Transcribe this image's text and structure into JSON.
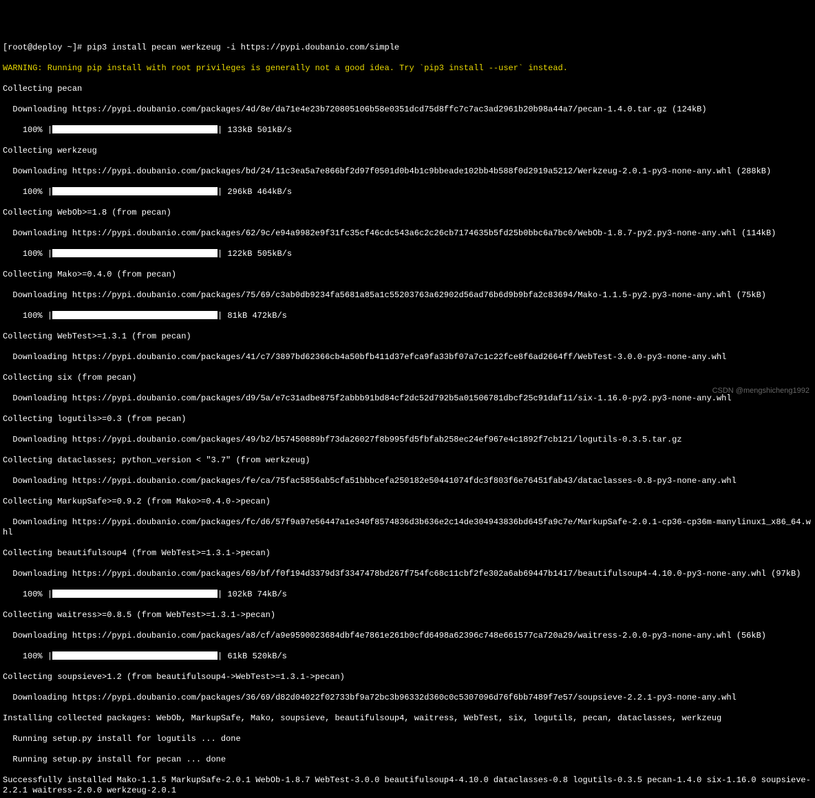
{
  "prompt": "[root@deploy ~]# pip3 install pecan werkzeug -i https://pypi.doubanio.com/simple",
  "warning": "WARNING: Running pip install with root privileges is generally not a good idea. Try `pip3 install --user` instead.",
  "l01": "Collecting pecan",
  "l02": "  Downloading https://pypi.doubanio.com/packages/4d/8e/da71e4e23b720805106b58e0351dcd75d8ffc7c7ac3ad2961b20b98a44a7/pecan-1.4.0.tar.gz (124kB)",
  "p01a": "    100% |",
  "p01b": "| 133kB 501kB/s",
  "l03": "Collecting werkzeug",
  "l04": "  Downloading https://pypi.doubanio.com/packages/bd/24/11c3ea5a7e866bf2d97f0501d0b4b1c9bbeade102bb4b588f0d2919a5212/Werkzeug-2.0.1-py3-none-any.whl (288kB)",
  "p02a": "    100% |",
  "p02b": "| 296kB 464kB/s",
  "l05": "Collecting WebOb>=1.8 (from pecan)",
  "l06": "  Downloading https://pypi.doubanio.com/packages/62/9c/e94a9982e9f31fc35cf46cdc543a6c2c26cb7174635b5fd25b0bbc6a7bc0/WebOb-1.8.7-py2.py3-none-any.whl (114kB)",
  "p03a": "    100% |",
  "p03b": "| 122kB 505kB/s",
  "l07": "Collecting Mako>=0.4.0 (from pecan)",
  "l08": "  Downloading https://pypi.doubanio.com/packages/75/69/c3ab0db9234fa5681a85a1c55203763a62902d56ad76b6d9b9bfa2c83694/Mako-1.1.5-py2.py3-none-any.whl (75kB)",
  "p04a": "    100% |",
  "p04b": "| 81kB 472kB/s",
  "l09": "Collecting WebTest>=1.3.1 (from pecan)",
  "l10": "  Downloading https://pypi.doubanio.com/packages/41/c7/3897bd62366cb4a50bfb411d37efca9fa33bf07a7c1c22fce8f6ad2664ff/WebTest-3.0.0-py3-none-any.whl",
  "l11": "Collecting six (from pecan)",
  "l12": "  Downloading https://pypi.doubanio.com/packages/d9/5a/e7c31adbe875f2abbb91bd84cf2dc52d792b5a01506781dbcf25c91daf11/six-1.16.0-py2.py3-none-any.whl",
  "l13": "Collecting logutils>=0.3 (from pecan)",
  "l14": "  Downloading https://pypi.doubanio.com/packages/49/b2/b57450889bf73da26027f8b995fd5fbfab258ec24ef967e4c1892f7cb121/logutils-0.3.5.tar.gz",
  "l15": "Collecting dataclasses; python_version < \"3.7\" (from werkzeug)",
  "l16": "  Downloading https://pypi.doubanio.com/packages/fe/ca/75fac5856ab5cfa51bbbcefa250182e50441074fdc3f803f6e76451fab43/dataclasses-0.8-py3-none-any.whl",
  "l17": "Collecting MarkupSafe>=0.9.2 (from Mako>=0.4.0->pecan)",
  "l18": "  Downloading https://pypi.doubanio.com/packages/fc/d6/57f9a97e56447a1e340f8574836d3b636e2c14de304943836bd645fa9c7e/MarkupSafe-2.0.1-cp36-cp36m-manylinux1_x86_64.whl",
  "l19": "Collecting beautifulsoup4 (from WebTest>=1.3.1->pecan)",
  "l20": "  Downloading https://pypi.doubanio.com/packages/69/bf/f0f194d3379d3f3347478bd267f754fc68c11cbf2fe302a6ab69447b1417/beautifulsoup4-4.10.0-py3-none-any.whl (97kB)",
  "p05a": "    100% |",
  "p05b": "| 102kB 74kB/s",
  "l21": "Collecting waitress>=0.8.5 (from WebTest>=1.3.1->pecan)",
  "l22": "  Downloading https://pypi.doubanio.com/packages/a8/cf/a9e9590023684dbf4e7861e261b0cfd6498a62396c748e661577ca720a29/waitress-2.0.0-py3-none-any.whl (56kB)",
  "p06a": "    100% |",
  "p06b": "| 61kB 520kB/s",
  "l23": "Collecting soupsieve>1.2 (from beautifulsoup4->WebTest>=1.3.1->pecan)",
  "l24": "  Downloading https://pypi.doubanio.com/packages/36/69/d82d04022f02733bf9a72bc3b96332d360c0c5307096d76f6bb7489f7e57/soupsieve-2.2.1-py3-none-any.whl",
  "l25": "Installing collected packages: WebOb, MarkupSafe, Mako, soupsieve, beautifulsoup4, waitress, WebTest, six, logutils, pecan, dataclasses, werkzeug",
  "l26": "  Running setup.py install for logutils ... done",
  "l27": "  Running setup.py install for pecan ... done",
  "l28": "Successfully installed Mako-1.1.5 MarkupSafe-2.0.1 WebOb-1.8.7 WebTest-3.0.0 beautifulsoup4-4.10.0 dataclasses-0.8 logutils-0.3.5 pecan-1.4.0 six-1.16.0 soupsieve-2.2.1 waitress-2.0.0 werkzeug-2.0.1",
  "watermark": "CSDN @mengshicheng1992"
}
